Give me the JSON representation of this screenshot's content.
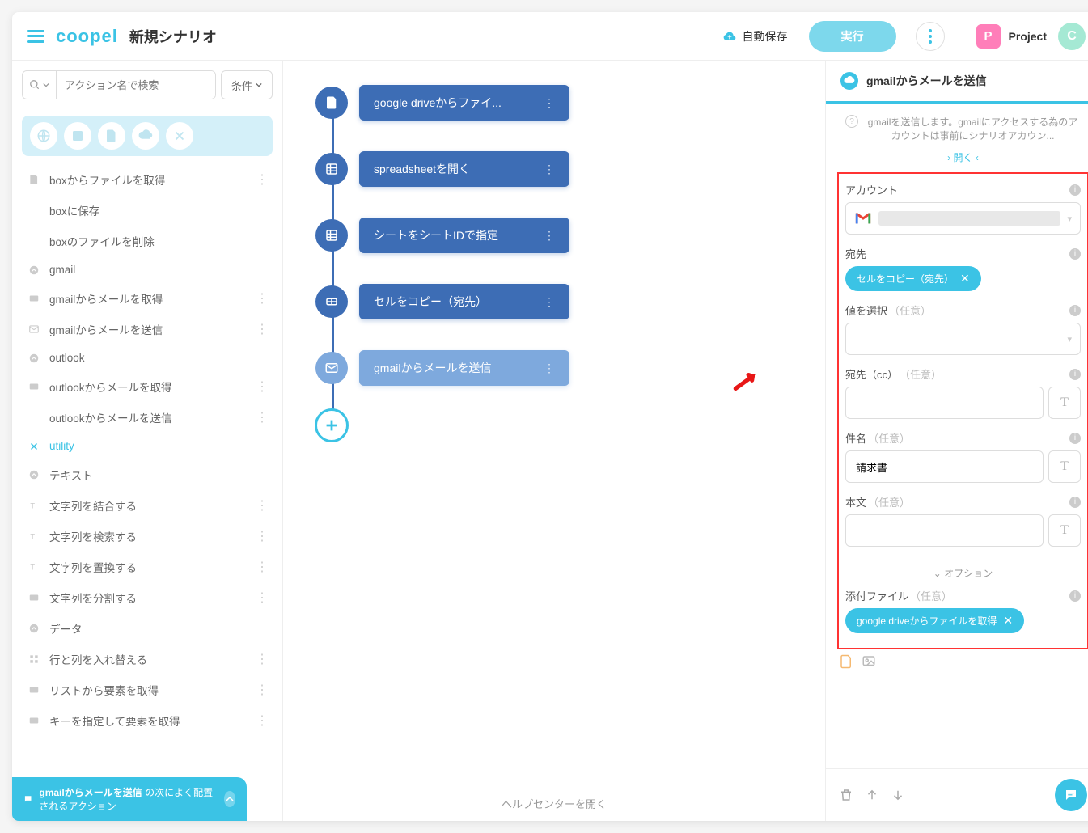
{
  "header": {
    "logo": "coopel",
    "title": "新規シナリオ",
    "autosave": "自動保存",
    "run": "実行",
    "project": "Project",
    "project_initial": "P",
    "avatar_initial": "C"
  },
  "sidebar": {
    "search_placeholder": "アクション名で検索",
    "filter": "条件",
    "items": [
      {
        "type": "action",
        "icon": "file",
        "label": "boxからファイルを取得",
        "more": true
      },
      {
        "type": "action",
        "icon": "",
        "label": "boxに保存",
        "more": false
      },
      {
        "type": "action",
        "icon": "",
        "label": "boxのファイルを削除",
        "more": false
      },
      {
        "type": "category",
        "icon": "chevron",
        "label": "gmail"
      },
      {
        "type": "action",
        "icon": "inbox",
        "label": "gmailからメールを取得",
        "more": true
      },
      {
        "type": "action",
        "icon": "mail",
        "label": "gmailからメールを送信",
        "more": true
      },
      {
        "type": "category",
        "icon": "chevron",
        "label": "outlook"
      },
      {
        "type": "action",
        "icon": "inbox",
        "label": "outlookからメールを取得",
        "more": true
      },
      {
        "type": "action",
        "icon": "",
        "label": "outlookからメールを送信",
        "more": true
      },
      {
        "type": "category",
        "icon": "utility",
        "label": "utility",
        "highlight": true
      },
      {
        "type": "category",
        "icon": "chevron",
        "label": "テキスト"
      },
      {
        "type": "action",
        "icon": "text",
        "label": "文字列を結合する",
        "more": true
      },
      {
        "type": "action",
        "icon": "text",
        "label": "文字列を検索する",
        "more": true
      },
      {
        "type": "action",
        "icon": "text",
        "label": "文字列を置換する",
        "more": true
      },
      {
        "type": "action",
        "icon": "inbox",
        "label": "文字列を分割する",
        "more": true
      },
      {
        "type": "category",
        "icon": "chevron",
        "label": "データ"
      },
      {
        "type": "action",
        "icon": "grid",
        "label": "行と列を入れ替える",
        "more": true
      },
      {
        "type": "action",
        "icon": "inbox",
        "label": "リストから要素を取得",
        "more": true
      },
      {
        "type": "action",
        "icon": "inbox",
        "label": "キーを指定して要素を取得",
        "more": true
      }
    ],
    "tip_bold": "gmailからメールを送信 ",
    "tip_rest": "の次によく配置されるアクション"
  },
  "canvas": {
    "nodes": [
      {
        "icon": "file",
        "label": "google driveからファイ..."
      },
      {
        "icon": "sheet",
        "label": "spreadsheetを開く"
      },
      {
        "icon": "sheet",
        "label": "シートをシートIDで指定"
      },
      {
        "icon": "cell",
        "label": "セルをコピー（宛先）"
      },
      {
        "icon": "mail",
        "label": "gmailからメールを送信",
        "light": true
      }
    ],
    "help": "ヘルプセンターを開く"
  },
  "panel": {
    "title": "gmailからメールを送信",
    "description": "gmailを送信します。gmailにアクセスする為のアカウントは事前にシナリオアカウン...",
    "open": "開く",
    "fields": {
      "account_label": "アカウント",
      "to_label": "宛先",
      "to_chip": "セルをコピー（宛先）",
      "select_label": "値を選択",
      "select_opt": "（任意）",
      "cc_label": "宛先（cc）",
      "cc_opt": "（任意）",
      "subject_label": "件名",
      "subject_opt": "（任意）",
      "subject_value": "請求書",
      "body_label": "本文",
      "body_opt": "（任意）",
      "options_toggle": "オプション",
      "attach_label": "添付ファイル",
      "attach_opt": "（任意）",
      "attach_chip": "google driveからファイルを取得"
    }
  }
}
